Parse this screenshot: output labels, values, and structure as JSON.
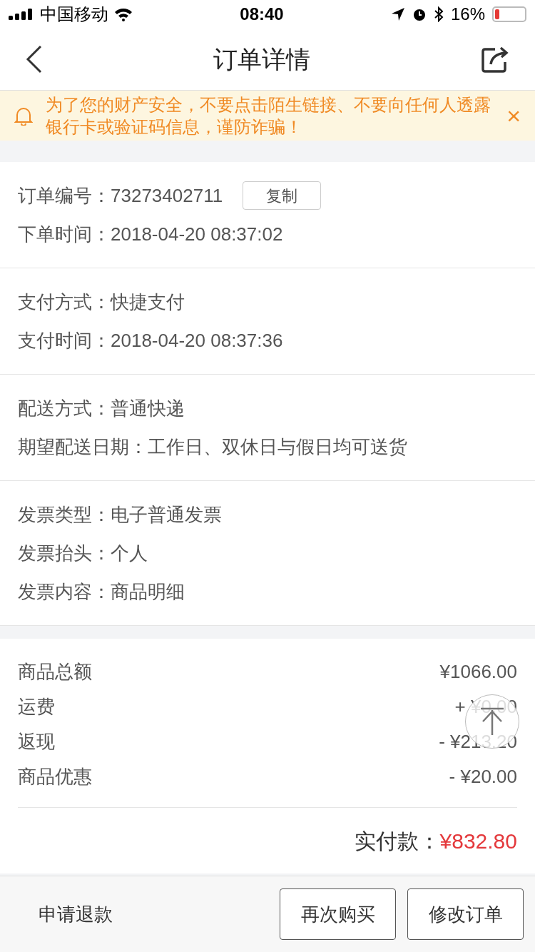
{
  "status_bar": {
    "carrier": "中国移动",
    "time": "08:40",
    "battery": {
      "text": "16%",
      "level": 0.16
    }
  },
  "nav": {
    "title": "订单详情"
  },
  "notice": {
    "text": "为了您的财产安全，不要点击陌生链接、不要向任何人透露银行卡或验证码信息，谨防诈骗！",
    "close": "×"
  },
  "sections": [
    {
      "rows": [
        {
          "label": "订单编号：",
          "value": "73273402711",
          "action": "复制"
        },
        {
          "label": "下单时间：",
          "value": "2018-04-20 08:37:02"
        }
      ]
    },
    {
      "rows": [
        {
          "label": "支付方式：",
          "value": "快捷支付"
        },
        {
          "label": "支付时间：",
          "value": "2018-04-20 08:37:36"
        }
      ]
    },
    {
      "rows": [
        {
          "label": "配送方式：",
          "value": "普通快递"
        },
        {
          "label": "期望配送日期：",
          "value": "工作日、双休日与假日均可送货"
        }
      ]
    },
    {
      "rows": [
        {
          "label": "发票类型：",
          "value": "电子普通发票"
        },
        {
          "label": "发票抬头：",
          "value": "个人"
        },
        {
          "label": "发票内容：",
          "value": "商品明细"
        }
      ]
    }
  ],
  "amounts": [
    {
      "label": "商品总额",
      "value": "¥1066.00"
    },
    {
      "label": "运费",
      "value": "+ ¥0.00"
    },
    {
      "label": "返现",
      "value": "- ¥213.20"
    },
    {
      "label": "商品优惠",
      "value": "- ¥20.00"
    }
  ],
  "total": {
    "label": "实付款：",
    "value": "¥832.80"
  },
  "footer": {
    "link": "申请退款",
    "buttons": [
      "再次购买",
      "修改订单"
    ]
  }
}
